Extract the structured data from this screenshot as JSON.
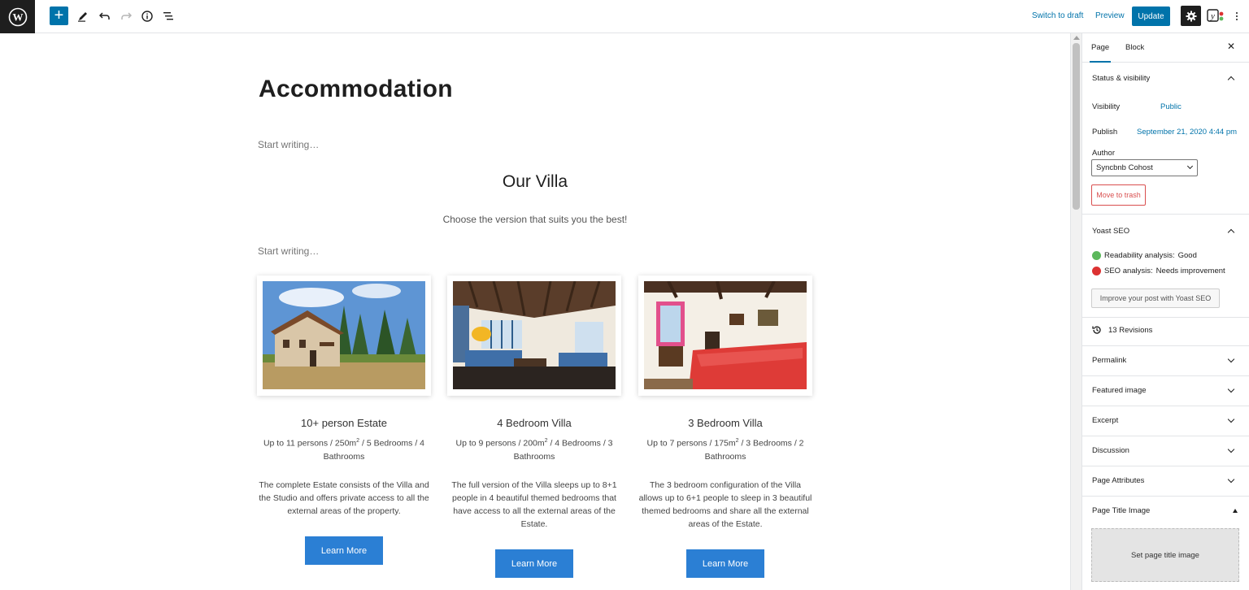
{
  "toolbar": {
    "switch_to_draft": "Switch to draft",
    "preview": "Preview",
    "update": "Update",
    "add_symbol": "+"
  },
  "document": {
    "title": "Accommodation",
    "placeholder_1": "Start writing…",
    "placeholder_2": "Start writing…",
    "section_heading": "Our Villa",
    "section_subtitle": "Choose the version that suits you the best!"
  },
  "cards": [
    {
      "title": "10+ person Estate",
      "meta_pre": "Up to 11 persons / 250m",
      "meta_sup": "2",
      "meta_post": " / 5 Bedrooms / 4 Bathrooms",
      "description": "The complete Estate consists of the Villa and the Studio and offers private access to all the external areas of the property.",
      "button": "Learn More"
    },
    {
      "title": "4 Bedroom Villa",
      "meta_pre": "Up to 9 persons / 200m",
      "meta_sup": "2",
      "meta_post": " / 4 Bedrooms / 3 Bathrooms",
      "description": "The full version of the Villa sleeps up to 8+1 people in 4 beautiful themed bedrooms that have access to all the external areas of the Estate.",
      "button": "Learn More"
    },
    {
      "title": "3 Bedroom Villa",
      "meta_pre": "Up to 7 persons / 175m",
      "meta_sup": "2",
      "meta_post": " / 3 Bedrooms / 2 Bathrooms",
      "description": "The 3 bedroom configuration of the Villa allows up to 6+1 people to sleep in 3 beautiful themed bedrooms and share all the external areas of the Estate.",
      "button": "Learn More"
    }
  ],
  "sidebar": {
    "tabs": [
      "Page",
      "Block"
    ],
    "close": "✕",
    "status": {
      "heading": "Status & visibility",
      "visibility_label": "Visibility",
      "visibility_value": "Public",
      "publish_label": "Publish",
      "publish_value": "September 21, 2020 4:44 pm",
      "author_label": "Author",
      "author_value": "Syncbnb Cohost",
      "trash": "Move to trash"
    },
    "yoast": {
      "heading": "Yoast SEO",
      "readability_label": "Readability analysis:",
      "readability_value": "Good",
      "seo_label": "SEO analysis:",
      "seo_value": "Needs improvement",
      "improve_button": "Improve your post with Yoast SEO"
    },
    "revisions": "13 Revisions",
    "panels": [
      "Permalink",
      "Featured image",
      "Excerpt",
      "Discussion",
      "Page Attributes",
      "Page Title Image"
    ],
    "title_image_button": "Set page title image"
  },
  "colors": {
    "accent": "#0073aa",
    "button_blue": "#2b7fd4",
    "trash_red": "#d94f4f",
    "good_green": "#5cb85c",
    "bad_red": "#dc3232"
  }
}
